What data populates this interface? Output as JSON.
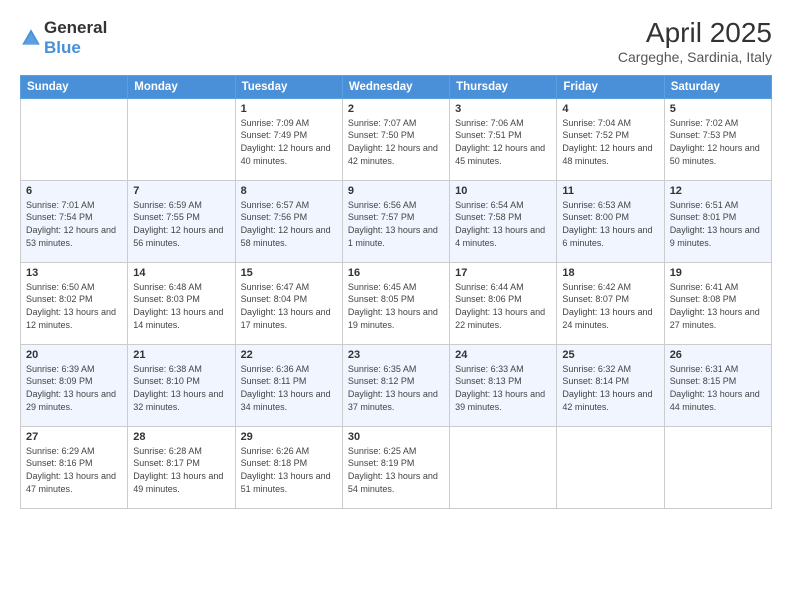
{
  "logo": {
    "general": "General",
    "blue": "Blue"
  },
  "title": "April 2025",
  "location": "Cargeghe, Sardinia, Italy",
  "weekdays": [
    "Sunday",
    "Monday",
    "Tuesday",
    "Wednesday",
    "Thursday",
    "Friday",
    "Saturday"
  ],
  "weeks": [
    [
      {
        "day": "",
        "info": ""
      },
      {
        "day": "",
        "info": ""
      },
      {
        "day": "1",
        "info": "Sunrise: 7:09 AM\nSunset: 7:49 PM\nDaylight: 12 hours and 40 minutes."
      },
      {
        "day": "2",
        "info": "Sunrise: 7:07 AM\nSunset: 7:50 PM\nDaylight: 12 hours and 42 minutes."
      },
      {
        "day": "3",
        "info": "Sunrise: 7:06 AM\nSunset: 7:51 PM\nDaylight: 12 hours and 45 minutes."
      },
      {
        "day": "4",
        "info": "Sunrise: 7:04 AM\nSunset: 7:52 PM\nDaylight: 12 hours and 48 minutes."
      },
      {
        "day": "5",
        "info": "Sunrise: 7:02 AM\nSunset: 7:53 PM\nDaylight: 12 hours and 50 minutes."
      }
    ],
    [
      {
        "day": "6",
        "info": "Sunrise: 7:01 AM\nSunset: 7:54 PM\nDaylight: 12 hours and 53 minutes."
      },
      {
        "day": "7",
        "info": "Sunrise: 6:59 AM\nSunset: 7:55 PM\nDaylight: 12 hours and 56 minutes."
      },
      {
        "day": "8",
        "info": "Sunrise: 6:57 AM\nSunset: 7:56 PM\nDaylight: 12 hours and 58 minutes."
      },
      {
        "day": "9",
        "info": "Sunrise: 6:56 AM\nSunset: 7:57 PM\nDaylight: 13 hours and 1 minute."
      },
      {
        "day": "10",
        "info": "Sunrise: 6:54 AM\nSunset: 7:58 PM\nDaylight: 13 hours and 4 minutes."
      },
      {
        "day": "11",
        "info": "Sunrise: 6:53 AM\nSunset: 8:00 PM\nDaylight: 13 hours and 6 minutes."
      },
      {
        "day": "12",
        "info": "Sunrise: 6:51 AM\nSunset: 8:01 PM\nDaylight: 13 hours and 9 minutes."
      }
    ],
    [
      {
        "day": "13",
        "info": "Sunrise: 6:50 AM\nSunset: 8:02 PM\nDaylight: 13 hours and 12 minutes."
      },
      {
        "day": "14",
        "info": "Sunrise: 6:48 AM\nSunset: 8:03 PM\nDaylight: 13 hours and 14 minutes."
      },
      {
        "day": "15",
        "info": "Sunrise: 6:47 AM\nSunset: 8:04 PM\nDaylight: 13 hours and 17 minutes."
      },
      {
        "day": "16",
        "info": "Sunrise: 6:45 AM\nSunset: 8:05 PM\nDaylight: 13 hours and 19 minutes."
      },
      {
        "day": "17",
        "info": "Sunrise: 6:44 AM\nSunset: 8:06 PM\nDaylight: 13 hours and 22 minutes."
      },
      {
        "day": "18",
        "info": "Sunrise: 6:42 AM\nSunset: 8:07 PM\nDaylight: 13 hours and 24 minutes."
      },
      {
        "day": "19",
        "info": "Sunrise: 6:41 AM\nSunset: 8:08 PM\nDaylight: 13 hours and 27 minutes."
      }
    ],
    [
      {
        "day": "20",
        "info": "Sunrise: 6:39 AM\nSunset: 8:09 PM\nDaylight: 13 hours and 29 minutes."
      },
      {
        "day": "21",
        "info": "Sunrise: 6:38 AM\nSunset: 8:10 PM\nDaylight: 13 hours and 32 minutes."
      },
      {
        "day": "22",
        "info": "Sunrise: 6:36 AM\nSunset: 8:11 PM\nDaylight: 13 hours and 34 minutes."
      },
      {
        "day": "23",
        "info": "Sunrise: 6:35 AM\nSunset: 8:12 PM\nDaylight: 13 hours and 37 minutes."
      },
      {
        "day": "24",
        "info": "Sunrise: 6:33 AM\nSunset: 8:13 PM\nDaylight: 13 hours and 39 minutes."
      },
      {
        "day": "25",
        "info": "Sunrise: 6:32 AM\nSunset: 8:14 PM\nDaylight: 13 hours and 42 minutes."
      },
      {
        "day": "26",
        "info": "Sunrise: 6:31 AM\nSunset: 8:15 PM\nDaylight: 13 hours and 44 minutes."
      }
    ],
    [
      {
        "day": "27",
        "info": "Sunrise: 6:29 AM\nSunset: 8:16 PM\nDaylight: 13 hours and 47 minutes."
      },
      {
        "day": "28",
        "info": "Sunrise: 6:28 AM\nSunset: 8:17 PM\nDaylight: 13 hours and 49 minutes."
      },
      {
        "day": "29",
        "info": "Sunrise: 6:26 AM\nSunset: 8:18 PM\nDaylight: 13 hours and 51 minutes."
      },
      {
        "day": "30",
        "info": "Sunrise: 6:25 AM\nSunset: 8:19 PM\nDaylight: 13 hours and 54 minutes."
      },
      {
        "day": "",
        "info": ""
      },
      {
        "day": "",
        "info": ""
      },
      {
        "day": "",
        "info": ""
      }
    ]
  ]
}
